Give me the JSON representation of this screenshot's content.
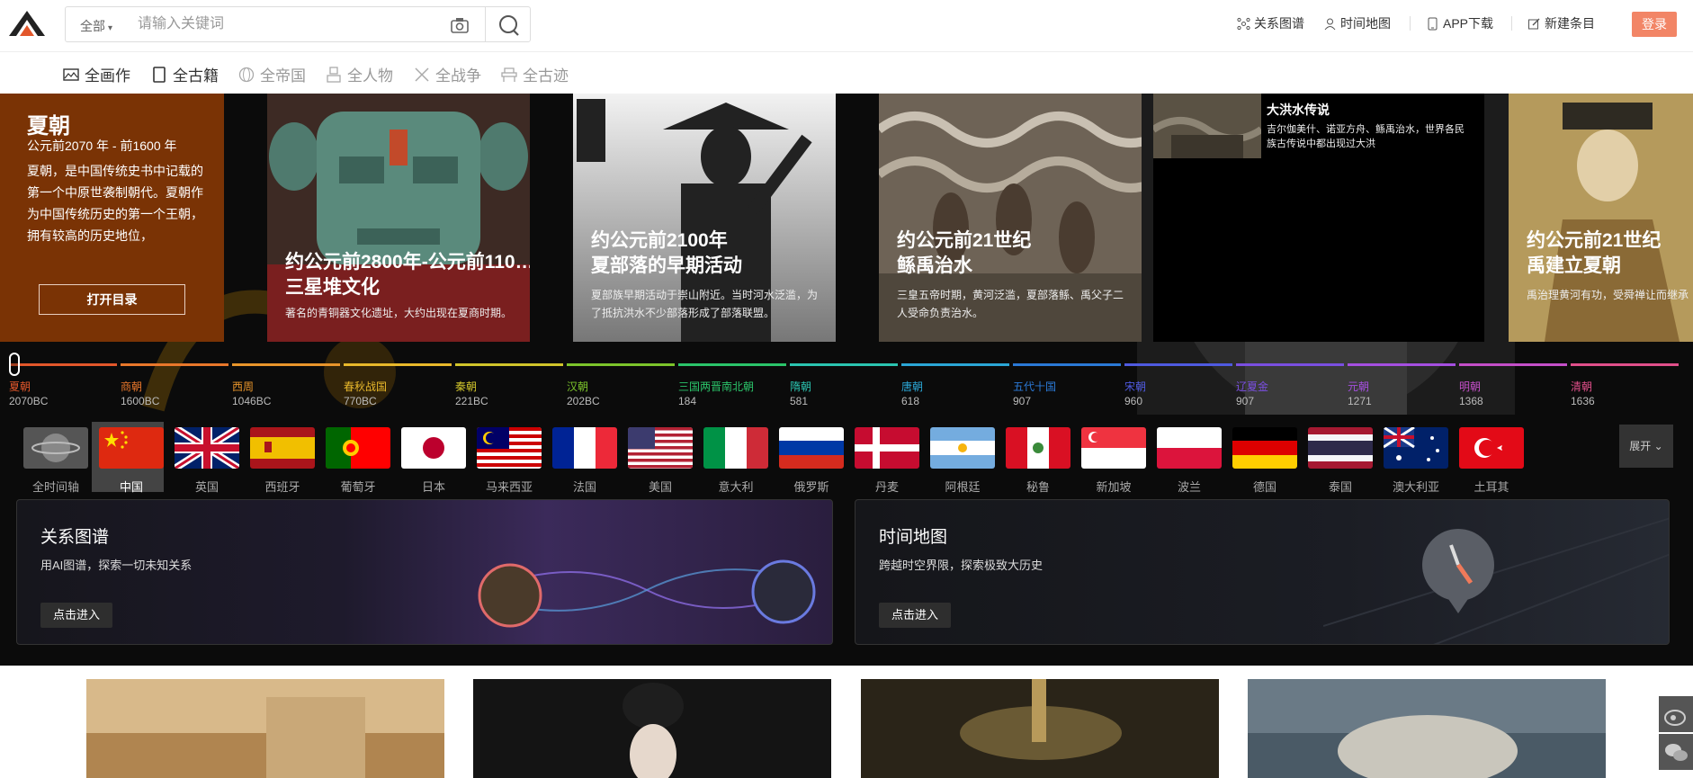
{
  "header": {
    "search_scope": "全部",
    "search_placeholder": "请输入关键词",
    "nav": [
      {
        "label": "关系图谱",
        "icon": "graph-icon"
      },
      {
        "label": "时间地图",
        "icon": "person-pin-icon"
      },
      {
        "label": "APP下载",
        "icon": "phone-icon"
      },
      {
        "label": "新建条目",
        "icon": "edit-icon"
      }
    ],
    "login": "登录"
  },
  "categories": [
    {
      "label": "全画作",
      "icon": "painting-icon",
      "active": true
    },
    {
      "label": "全古籍",
      "icon": "book-icon",
      "active": true
    },
    {
      "label": "全帝国",
      "icon": "globe-icon",
      "active": false
    },
    {
      "label": "全人物",
      "icon": "person-icon",
      "active": false
    },
    {
      "label": "全战争",
      "icon": "swords-icon",
      "active": false
    },
    {
      "label": "全古迹",
      "icon": "monument-icon",
      "active": false
    }
  ],
  "hero": {
    "intro": {
      "title": "夏朝",
      "range": "公元前2070 年 - 前1600 年",
      "desc": "夏朝，是中国传统史书中记载的第一个中原世袭制朝代。夏朝作为中国传统历史的第一个王朝，拥有较高的历史地位，",
      "button": "打开目录"
    },
    "cards": [
      {
        "title1": "约公元前2800年-公元前110…",
        "title2": "三星堆文化",
        "sub": "著名的青铜器文化遗址，大约出现在夏商时期。"
      },
      {
        "title1": "约公元前2100年",
        "title2": "夏部落的早期活动",
        "sub": "夏部族早期活动于崇山附近。当时河水泛滥，为了抵抗洪水不少部落形成了部落联盟。"
      },
      {
        "title1": "约公元前21世纪",
        "title2": "鲧禹治水",
        "sub": "三皇五帝时期，黄河泛滥，夏部落鲧、禹父子二人受命负责治水。"
      },
      {
        "title1": "约公元前21世纪",
        "title2": "禹建立夏朝",
        "sub": "禹治理黄河有功，受舜禅让而继承帝位，国号“夏”。夏成为中国第一个奴隶制"
      }
    ],
    "flood": {
      "title": "大洪水传说",
      "desc": "吉尔伽美什、诺亚方舟、鲧禹治水，世界各民族古传说中都出现过大洪"
    }
  },
  "timeline": [
    {
      "name": "夏朝",
      "year": "2070BC",
      "color": "#e2572b"
    },
    {
      "name": "商朝",
      "year": "1600BC",
      "color": "#e8772b"
    },
    {
      "name": "西周",
      "year": "1046BC",
      "color": "#e8952b"
    },
    {
      "name": "春秋战国",
      "year": "770BC",
      "color": "#e8b82b"
    },
    {
      "name": "秦朝",
      "year": "221BC",
      "color": "#d0c42b"
    },
    {
      "name": "汉朝",
      "year": "202BC",
      "color": "#7cc42b"
    },
    {
      "name": "三国两晋南北朝",
      "year": "184",
      "color": "#2bc46a"
    },
    {
      "name": "隋朝",
      "year": "581",
      "color": "#2bc4b0"
    },
    {
      "name": "唐朝",
      "year": "618",
      "color": "#2ba6d6"
    },
    {
      "name": "五代十国",
      "year": "907",
      "color": "#2b79d6"
    },
    {
      "name": "宋朝",
      "year": "960",
      "color": "#4f5ae0"
    },
    {
      "name": "辽夏金",
      "year": "907",
      "color": "#7a4fe0"
    },
    {
      "name": "元朝",
      "year": "1271",
      "color": "#a54fe0"
    },
    {
      "name": "明朝",
      "year": "1368",
      "color": "#c44fc8"
    },
    {
      "name": "清朝",
      "year": "1636",
      "color": "#e04f8a"
    }
  ],
  "countries": [
    {
      "name": "全时间轴",
      "flag": "globe"
    },
    {
      "name": "中国",
      "flag": "cn"
    },
    {
      "name": "英国",
      "flag": "gb"
    },
    {
      "name": "西班牙",
      "flag": "es"
    },
    {
      "name": "葡萄牙",
      "flag": "pt"
    },
    {
      "name": "日本",
      "flag": "jp"
    },
    {
      "name": "马来西亚",
      "flag": "my"
    },
    {
      "name": "法国",
      "flag": "fr"
    },
    {
      "name": "美国",
      "flag": "us"
    },
    {
      "name": "意大利",
      "flag": "it"
    },
    {
      "name": "俄罗斯",
      "flag": "ru"
    },
    {
      "name": "丹麦",
      "flag": "dk"
    },
    {
      "name": "阿根廷",
      "flag": "ar"
    },
    {
      "name": "秘鲁",
      "flag": "pe"
    },
    {
      "name": "新加坡",
      "flag": "sg"
    },
    {
      "name": "波兰",
      "flag": "pl"
    },
    {
      "name": "德国",
      "flag": "de"
    },
    {
      "name": "泰国",
      "flag": "th"
    },
    {
      "name": "澳大利亚",
      "flag": "au"
    },
    {
      "name": "土耳其",
      "flag": "tr"
    }
  ],
  "countries_selected": "中国",
  "expand_label": "展开",
  "features": [
    {
      "title": "关系图谱",
      "desc": "用AI图谱，探索一切未知关系",
      "button": "点击进入"
    },
    {
      "title": "时间地图",
      "desc": "跨越时空界限，探索极致大历史",
      "button": "点击进入"
    }
  ]
}
